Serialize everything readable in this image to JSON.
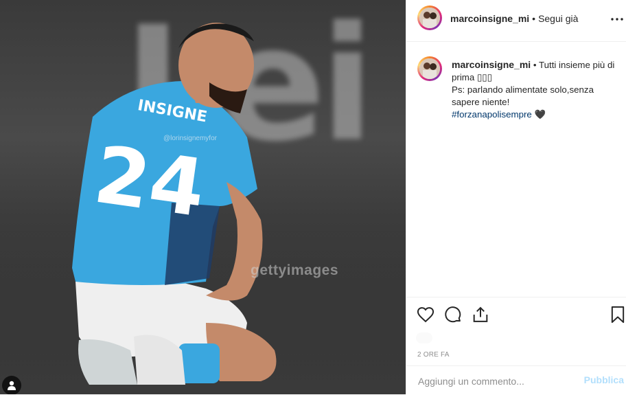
{
  "post": {
    "username": "marcoinsigne_mi",
    "follow_status": "Segui già",
    "separator": "•",
    "photo_watermark": "gettyimages",
    "photo_tag": "@lorinsignemyfor",
    "photo_bg_text": "Lei"
  },
  "caption": {
    "username": "marcoinsigne_mi",
    "separator": "•",
    "line1": "Tutti insieme più di prima ▯▯▯",
    "line2": "Ps: parlando alimentate solo,senza sapere niente!",
    "hashtag": "#forzanapolisempre",
    "heart": "🖤"
  },
  "actions": {
    "time": "2 ORE FA",
    "comment_placeholder": "Aggiungi un commento...",
    "publish_label": "Pubblica"
  },
  "icons": {
    "like": "heart-icon",
    "comment": "comment-icon",
    "share": "share-icon",
    "save": "bookmark-icon",
    "more": "more-icon",
    "profile": "profile-icon"
  },
  "colors": {
    "link": "#00376b",
    "publish": "#b2dffc",
    "jersey": "#3aa7df"
  }
}
